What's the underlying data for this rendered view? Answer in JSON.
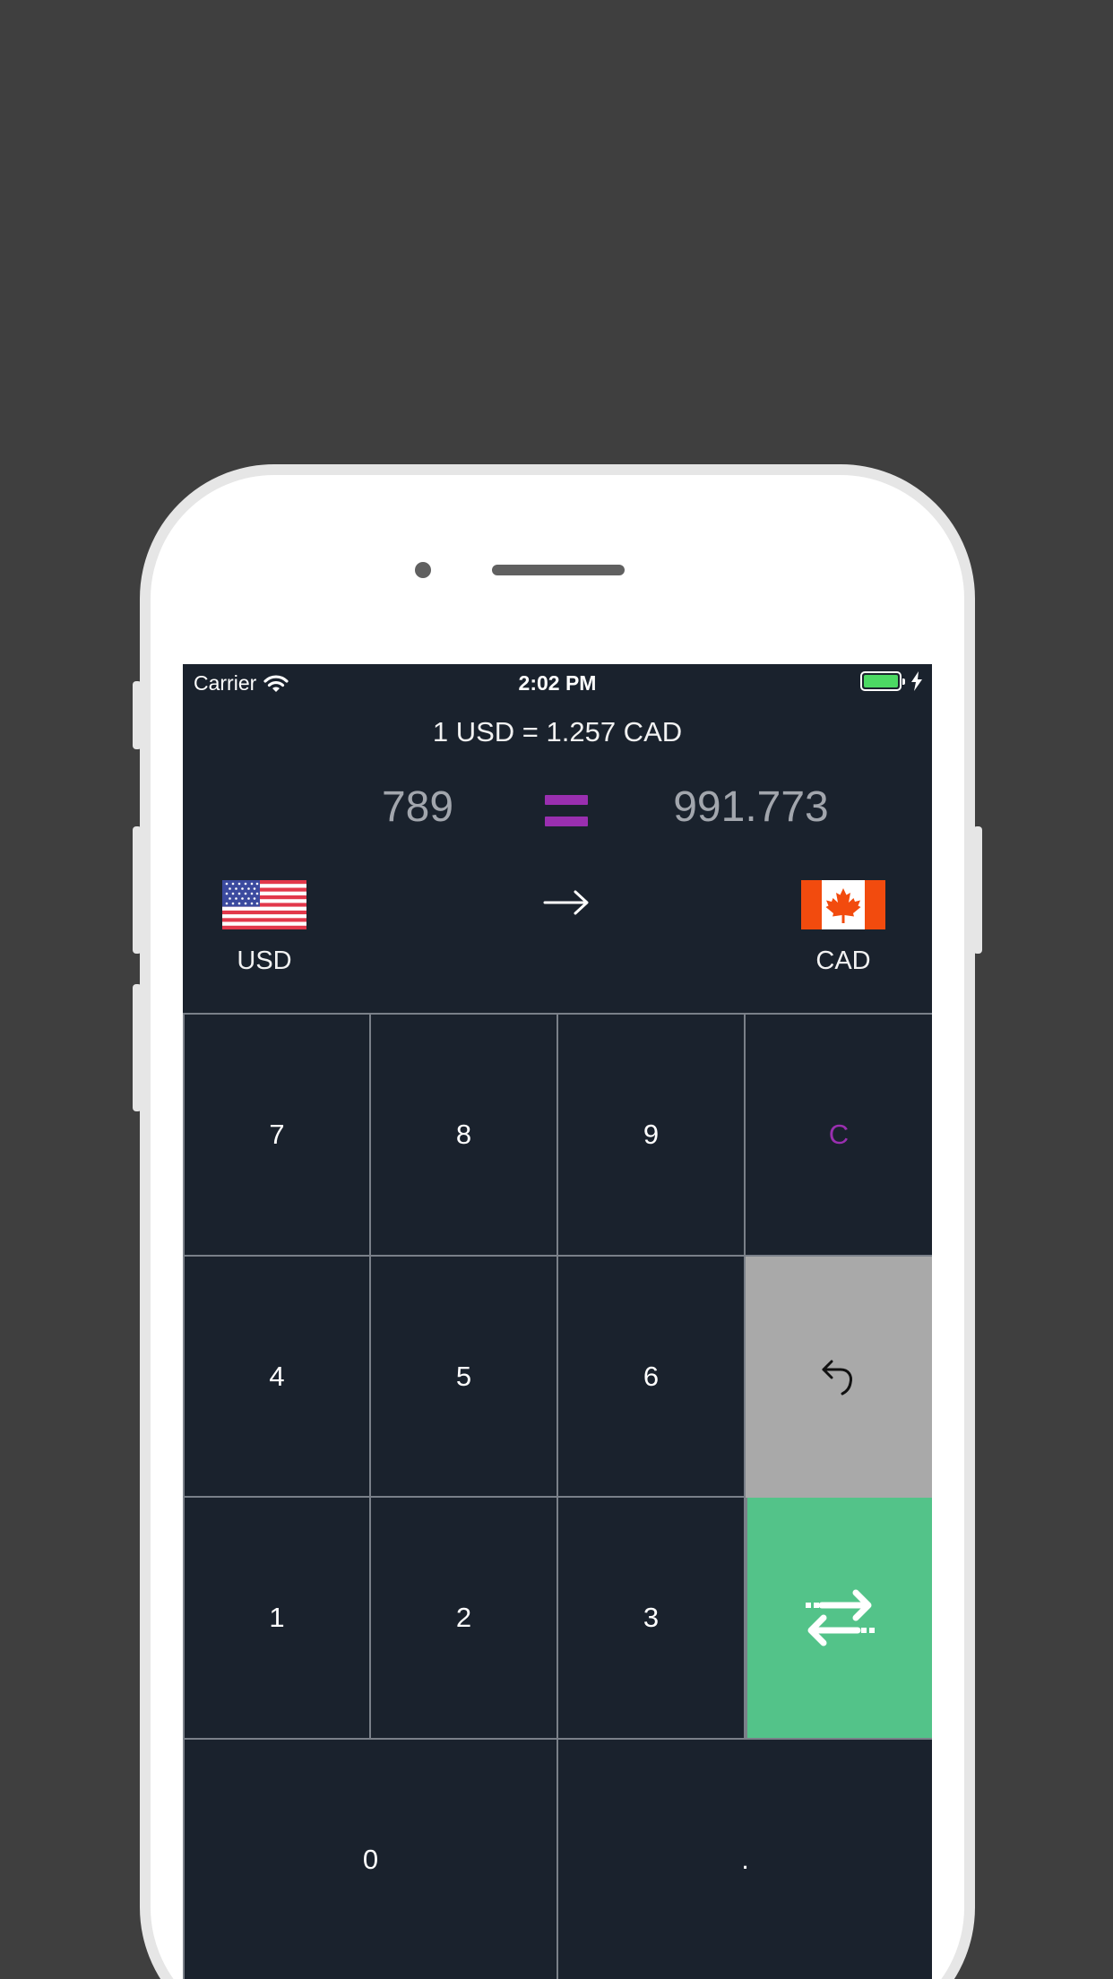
{
  "status_bar": {
    "carrier": "Carrier",
    "time": "2:02 PM",
    "wifi_icon": "wifi-icon",
    "battery_icon": "battery-icon",
    "charging_icon": "bolt-icon"
  },
  "converter": {
    "rate_text": "1 USD = 1.257 CAD",
    "from_amount": "789",
    "to_amount": "991.773",
    "from_currency": "USD",
    "to_currency": "CAD",
    "from_flag": "us-flag-icon",
    "to_flag": "canada-flag-icon",
    "direction_icon": "arrow-right-icon"
  },
  "keypad": {
    "k7": "7",
    "k8": "8",
    "k9": "9",
    "clear": "C",
    "k4": "4",
    "k5": "5",
    "k6": "6",
    "backspace_icon": "undo-arrow-icon",
    "k1": "1",
    "k2": "2",
    "k3": "3",
    "swap_icon": "swap-arrows-icon",
    "k0": "0",
    "dot": "."
  },
  "colors": {
    "background": "#1a222d",
    "accent_purple": "#9a2fb0",
    "swap_green": "#53c389",
    "backspace_gray": "#a9a9a9",
    "amount_gray": "#a2a6ad"
  }
}
